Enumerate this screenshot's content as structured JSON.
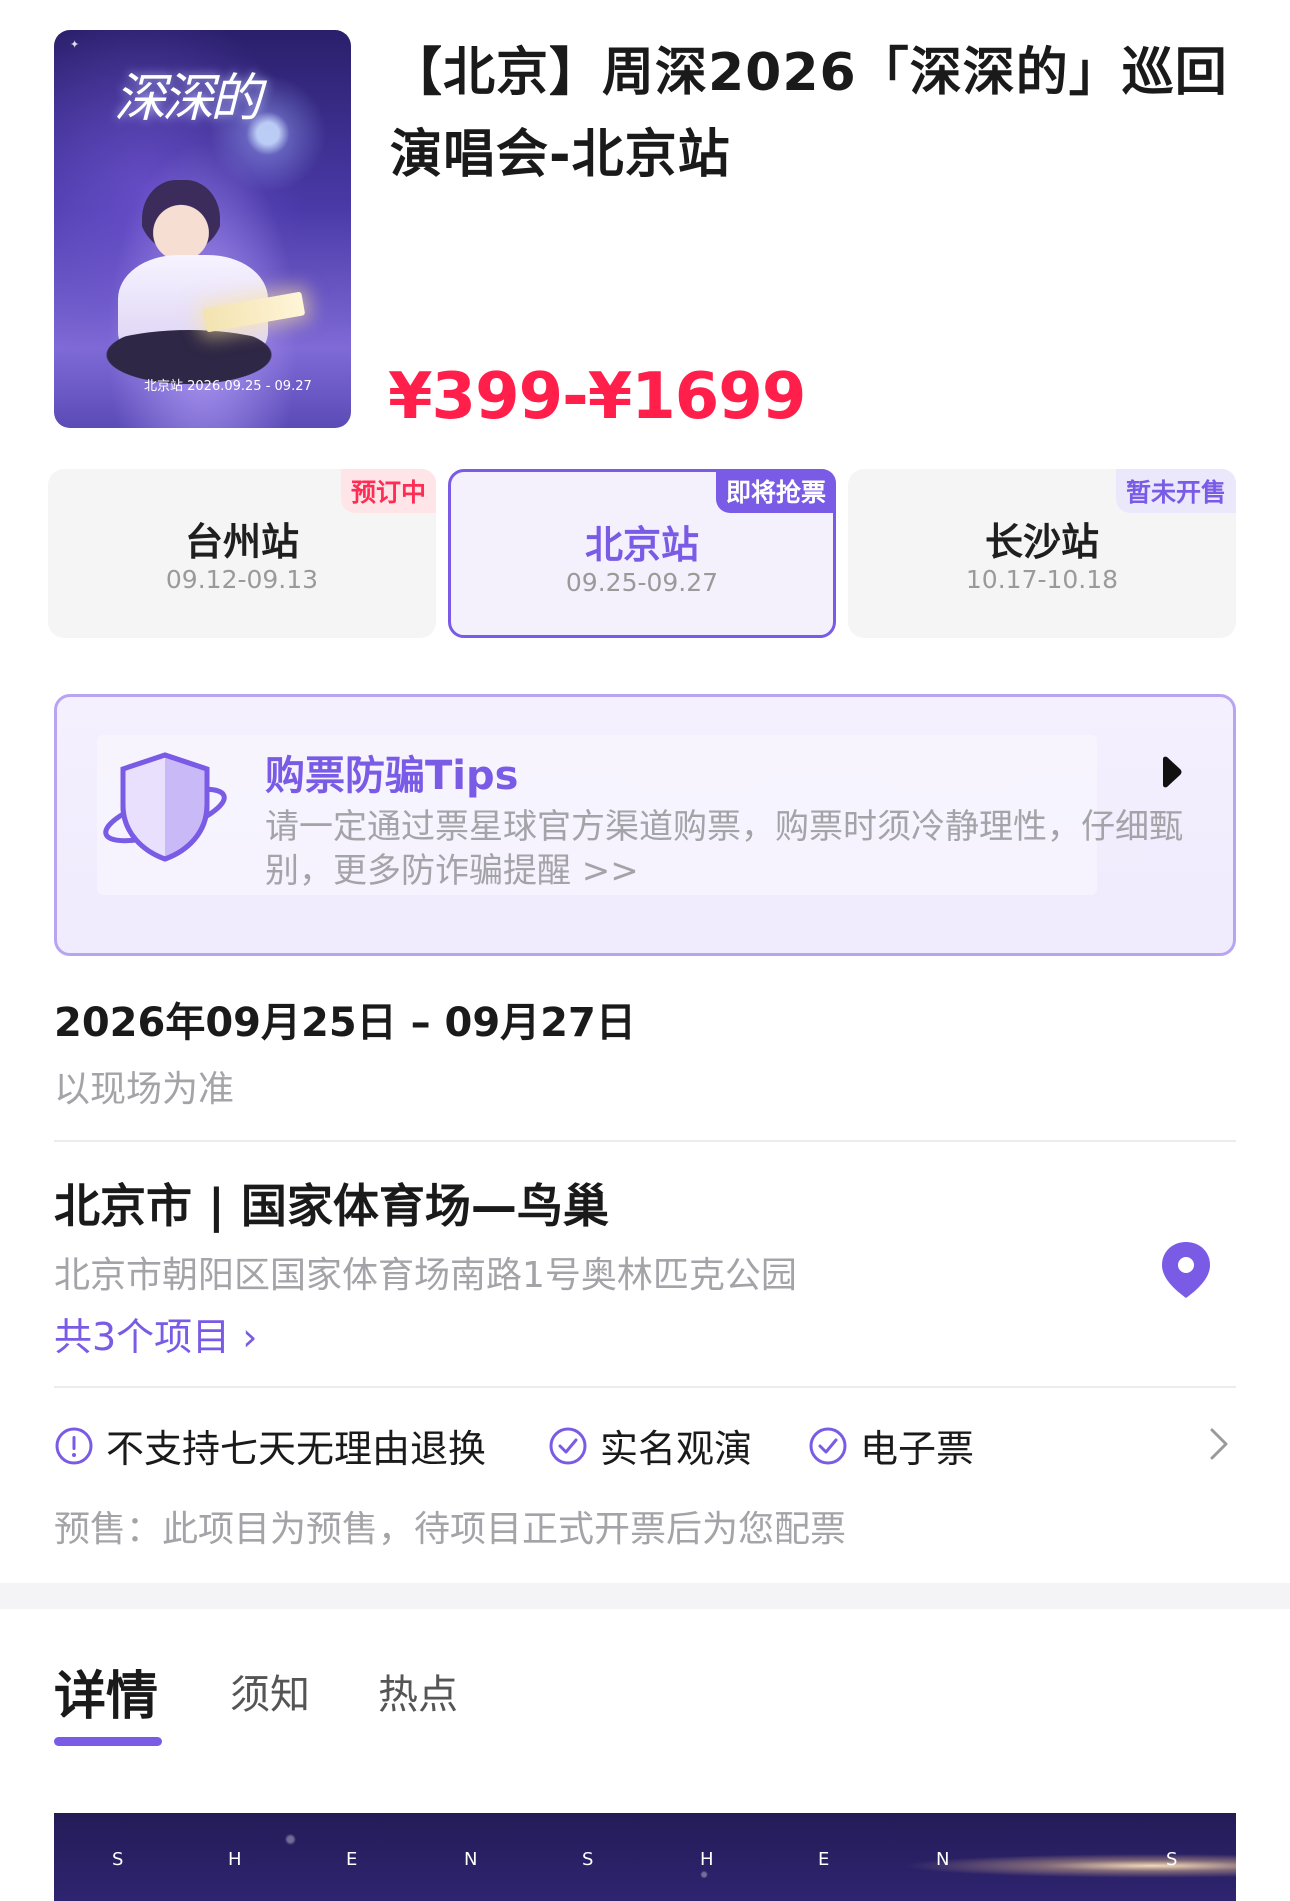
{
  "event": {
    "poster": {
      "art_title": "深深的",
      "station_line": "北京站 2026.09.25 - 09.27"
    },
    "title": "【北京】周深2026「深深的」巡回演唱会-北京站",
    "price": "¥399-¥1699"
  },
  "stations": [
    {
      "name": "台州站",
      "dates": "09.12-09.13",
      "badge": "预订中",
      "selected": false
    },
    {
      "name": "北京站",
      "dates": "09.25-09.27",
      "badge": "即将抢票",
      "selected": true
    },
    {
      "name": "长沙站",
      "dates": "10.17-10.18",
      "badge": "暂未开售",
      "selected": false
    }
  ],
  "tips": {
    "title": "购票防骗Tips",
    "text": "请一定通过票星球官方渠道购票，购票时须冷静理性，仔细甄别，更多防诈骗提醒 >>"
  },
  "schedule": {
    "date": "2026年09月25日 – 09月27日",
    "note": "以现场为准"
  },
  "venue": {
    "name": "北京市 | 国家体育场—鸟巢",
    "address": "北京市朝阳区国家体育场南路1号奥林匹克公园",
    "more": "共3个项目 ›"
  },
  "policies": [
    {
      "icon": "exclamation-circle-icon",
      "label": "不支持七天无理由退换"
    },
    {
      "icon": "check-circle-icon",
      "label": "实名观演"
    },
    {
      "icon": "check-circle-icon",
      "label": "电子票"
    }
  ],
  "presale": "预售：此项目为预售，待项目正式开票后为您配票",
  "tabs": [
    {
      "label": "详情",
      "active": true
    },
    {
      "label": "须知",
      "active": false
    },
    {
      "label": "热点",
      "active": false
    }
  ],
  "banner": {
    "letters": [
      "S",
      "H",
      "E",
      "N",
      "S",
      "H",
      "E",
      "N",
      "S"
    ]
  },
  "colors": {
    "accent": "#7a5be6",
    "price": "#ff1f4a",
    "muted": "#a3a3a8"
  }
}
